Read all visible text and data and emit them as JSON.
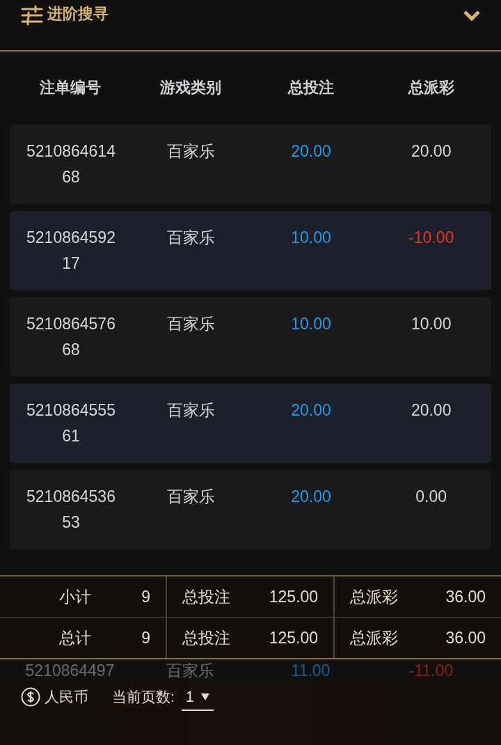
{
  "filter": {
    "title": "进阶搜寻",
    "expanded": false
  },
  "table": {
    "columns": [
      "注单编号",
      "游戏类别",
      "总投注",
      "总派彩"
    ],
    "rows": [
      {
        "id": "521086461468",
        "game": "百家乐",
        "bet": "20.00",
        "payout": "20.00",
        "loss": false
      },
      {
        "id": "521086459217",
        "game": "百家乐",
        "bet": "10.00",
        "payout": "-10.00",
        "loss": true
      },
      {
        "id": "521086457668",
        "game": "百家乐",
        "bet": "10.00",
        "payout": "10.00",
        "loss": false
      },
      {
        "id": "521086455561",
        "game": "百家乐",
        "bet": "20.00",
        "payout": "20.00",
        "loss": false
      },
      {
        "id": "521086453653",
        "game": "百家乐",
        "bet": "20.00",
        "payout": "0.00",
        "loss": false
      }
    ],
    "partial_row": {
      "id": "5210864497",
      "game": "百家乐",
      "bet": "11.00",
      "payout": "-11.00",
      "loss": true
    }
  },
  "summary": [
    {
      "label": "小计",
      "count": "9",
      "bet_label": "总投注",
      "bet": "125.00",
      "payout_label": "总派彩",
      "payout": "36.00"
    },
    {
      "label": "总计",
      "count": "9",
      "bet_label": "总投注",
      "bet": "125.00",
      "payout_label": "总派彩",
      "payout": "36.00"
    }
  ],
  "footer": {
    "currency": "人民币",
    "page_label": "当前页数:",
    "page": "1"
  }
}
